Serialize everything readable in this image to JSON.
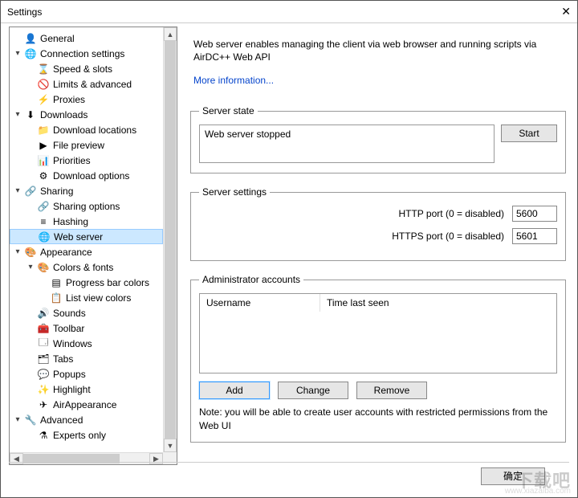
{
  "window": {
    "title": "Settings"
  },
  "tree": {
    "items": [
      {
        "label": "General",
        "depth": 0,
        "expander": "",
        "icon": "user-icon",
        "sel": false
      },
      {
        "label": "Connection settings",
        "depth": 0,
        "expander": "▾",
        "icon": "globe-icon",
        "sel": false
      },
      {
        "label": "Speed & slots",
        "depth": 1,
        "expander": "",
        "icon": "hourglass-icon",
        "sel": false
      },
      {
        "label": "Limits & advanced",
        "depth": 1,
        "expander": "",
        "icon": "sign-icon",
        "sel": false
      },
      {
        "label": "Proxies",
        "depth": 1,
        "expander": "",
        "icon": "bolt-icon",
        "sel": false
      },
      {
        "label": "Downloads",
        "depth": 0,
        "expander": "▾",
        "icon": "down-icon",
        "sel": false
      },
      {
        "label": "Download locations",
        "depth": 1,
        "expander": "",
        "icon": "folder-icon",
        "sel": false
      },
      {
        "label": "File preview",
        "depth": 1,
        "expander": "",
        "icon": "play-icon",
        "sel": false
      },
      {
        "label": "Priorities",
        "depth": 1,
        "expander": "",
        "icon": "bars-icon",
        "sel": false
      },
      {
        "label": "Download options",
        "depth": 1,
        "expander": "",
        "icon": "gear-icon",
        "sel": false
      },
      {
        "label": "Sharing",
        "depth": 0,
        "expander": "▾",
        "icon": "share-icon",
        "sel": false
      },
      {
        "label": "Sharing options",
        "depth": 1,
        "expander": "",
        "icon": "share2-icon",
        "sel": false
      },
      {
        "label": "Hashing",
        "depth": 1,
        "expander": "",
        "icon": "hash-icon",
        "sel": false
      },
      {
        "label": "Web server",
        "depth": 1,
        "expander": "",
        "icon": "web-icon",
        "sel": true
      },
      {
        "label": "Appearance",
        "depth": 0,
        "expander": "▾",
        "icon": "palette-icon",
        "sel": false
      },
      {
        "label": "Colors & fonts",
        "depth": 1,
        "expander": "▾",
        "icon": "colors-icon",
        "sel": false
      },
      {
        "label": "Progress bar colors",
        "depth": 2,
        "expander": "",
        "icon": "progress-icon",
        "sel": false
      },
      {
        "label": "List view colors",
        "depth": 2,
        "expander": "",
        "icon": "list-icon",
        "sel": false
      },
      {
        "label": "Sounds",
        "depth": 1,
        "expander": "",
        "icon": "sound-icon",
        "sel": false
      },
      {
        "label": "Toolbar",
        "depth": 1,
        "expander": "",
        "icon": "toolbar-icon",
        "sel": false
      },
      {
        "label": "Windows",
        "depth": 1,
        "expander": "",
        "icon": "window-icon",
        "sel": false
      },
      {
        "label": "Tabs",
        "depth": 1,
        "expander": "",
        "icon": "tabs-icon",
        "sel": false
      },
      {
        "label": "Popups",
        "depth": 1,
        "expander": "",
        "icon": "popup-icon",
        "sel": false
      },
      {
        "label": "Highlight",
        "depth": 1,
        "expander": "",
        "icon": "highlight-icon",
        "sel": false
      },
      {
        "label": "AirAppearance",
        "depth": 1,
        "expander": "",
        "icon": "air-icon",
        "sel": false
      },
      {
        "label": "Advanced",
        "depth": 0,
        "expander": "▾",
        "icon": "wrench-icon",
        "sel": false
      },
      {
        "label": "Experts only",
        "depth": 1,
        "expander": "",
        "icon": "expert-icon",
        "sel": false
      }
    ]
  },
  "content": {
    "description": "Web server enables managing the client via web browser and running scripts via AirDC++ Web API",
    "more_info": "More information...",
    "server_state": {
      "legend": "Server state",
      "status": "Web server stopped",
      "start_btn": "Start"
    },
    "server_settings": {
      "legend": "Server settings",
      "http_label": "HTTP port (0 = disabled)",
      "http_value": "5600",
      "https_label": "HTTPS port (0 = disabled)",
      "https_value": "5601"
    },
    "admin_accounts": {
      "legend": "Administrator accounts",
      "col_username": "Username",
      "col_time": "Time last seen",
      "add_btn": "Add",
      "change_btn": "Change",
      "remove_btn": "Remove",
      "note": "Note: you will be able to create user accounts with restricted permissions from the Web UI"
    }
  },
  "footer": {
    "ok": "确定"
  },
  "watermark": {
    "main": "下载吧",
    "url": "www.xiazaiba.com"
  }
}
